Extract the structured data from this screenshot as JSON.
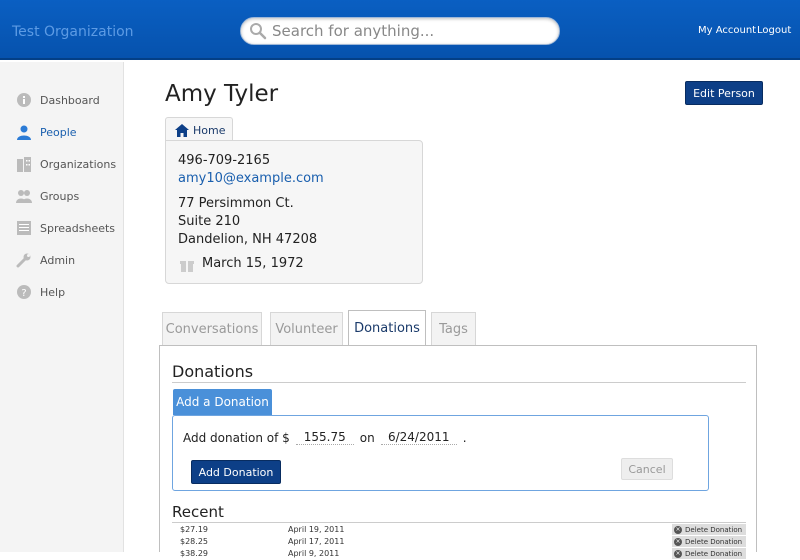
{
  "header": {
    "org_name": "Test Organization",
    "search_placeholder": "Search for anything...",
    "my_account": "My Account",
    "logout": "Logout"
  },
  "sidebar": {
    "items": [
      {
        "label": "Dashboard",
        "icon": "info-icon"
      },
      {
        "label": "People",
        "icon": "person-icon",
        "active": true
      },
      {
        "label": "Organizations",
        "icon": "building-icon"
      },
      {
        "label": "Groups",
        "icon": "group-icon"
      },
      {
        "label": "Spreadsheets",
        "icon": "spreadsheet-icon"
      },
      {
        "label": "Admin",
        "icon": "wrench-icon"
      },
      {
        "label": "Help",
        "icon": "help-icon"
      }
    ]
  },
  "person": {
    "name": "Amy Tyler",
    "edit_label": "Edit Person",
    "home_tab": "Home",
    "phone": "496-709-2165",
    "email": "amy10@example.com",
    "address1": "77 Persimmon Ct.",
    "address2": "Suite 210",
    "city_state_zip": "Dandelion, NH 47208",
    "birthday": "March 15, 1972"
  },
  "tabs": [
    {
      "label": "Conversations"
    },
    {
      "label": "Volunteer"
    },
    {
      "label": "Donations",
      "active": true
    },
    {
      "label": "Tags"
    }
  ],
  "donations": {
    "title": "Donations",
    "add_tab": "Add a Donation",
    "prefix": "Add donation of $",
    "amount": "155.75",
    "on": "on",
    "date": "6/24/2011",
    "suffix": ".",
    "add_button": "Add Donation",
    "cancel_button": "Cancel",
    "recent_title": "Recent",
    "delete_label": "Delete Donation",
    "recent": [
      {
        "amount": "$27.19",
        "date": "April 19, 2011"
      },
      {
        "amount": "$28.25",
        "date": "April 17, 2011"
      },
      {
        "amount": "$38.29",
        "date": "April 9, 2011"
      }
    ]
  },
  "colors": {
    "header_blue": "#0652ad",
    "primary_button": "#0d3f87",
    "accent_blue": "#4a90d9",
    "link_blue": "#1a5fae"
  }
}
